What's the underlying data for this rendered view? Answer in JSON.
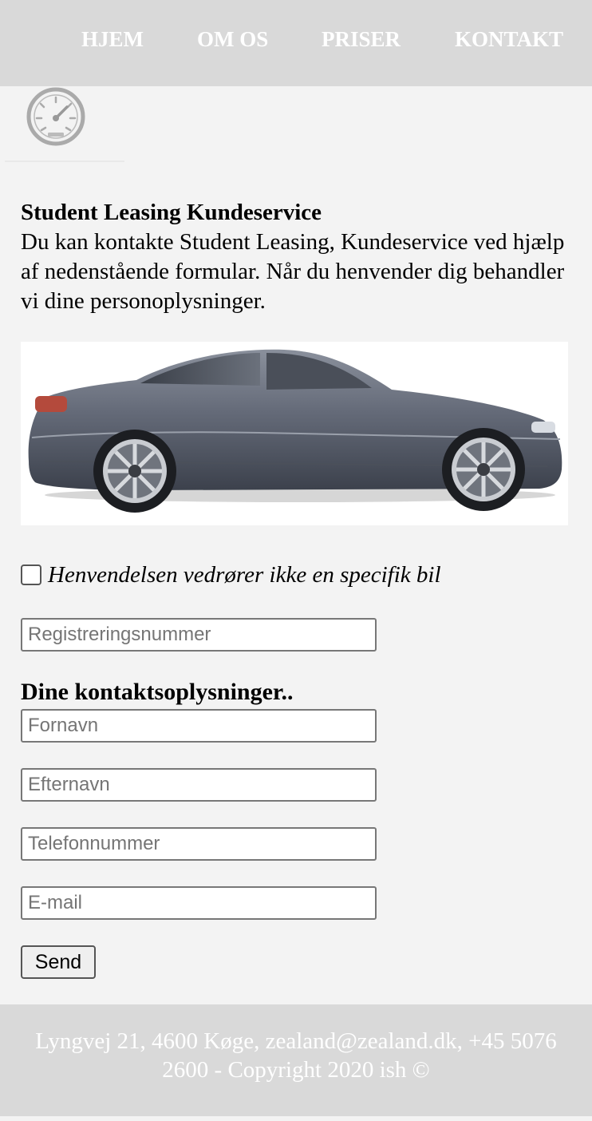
{
  "nav": {
    "items": [
      {
        "label": "HJEM"
      },
      {
        "label": "OM OS"
      },
      {
        "label": "PRISER"
      },
      {
        "label": "KONTAKT"
      }
    ]
  },
  "logo": {
    "icon": "speedometer-icon"
  },
  "intro": {
    "title": "Student Leasing Kundeservice",
    "body": "Du kan kontakte Student Leasing, Kundeservice ved hjælp af nedenstående formular. Når du henvender dig behandler vi dine personoplysninger."
  },
  "hero": {
    "image": "car-image"
  },
  "form": {
    "no_specific_car_label": "Henvendelsen vedrører ikke en specifik bil",
    "registration_placeholder": "Registreringsnummer",
    "contact_heading": "Dine kontaktsoplysninger..",
    "firstname_placeholder": "Fornavn",
    "lastname_placeholder": "Efternavn",
    "phone_placeholder": "Telefonnummer",
    "email_placeholder": "E-mail",
    "send_label": "Send"
  },
  "footer": {
    "text": "Lyngvej 21, 4600 Køge, zealand@zealand.dk, +45 5076 2600 - Copyright 2020 ish ©"
  },
  "colors": {
    "header_bg": "#d9d9d9",
    "page_bg": "#f3f3f3",
    "footer_bg": "#d9d9d9",
    "nav_text": "#ffffff"
  }
}
